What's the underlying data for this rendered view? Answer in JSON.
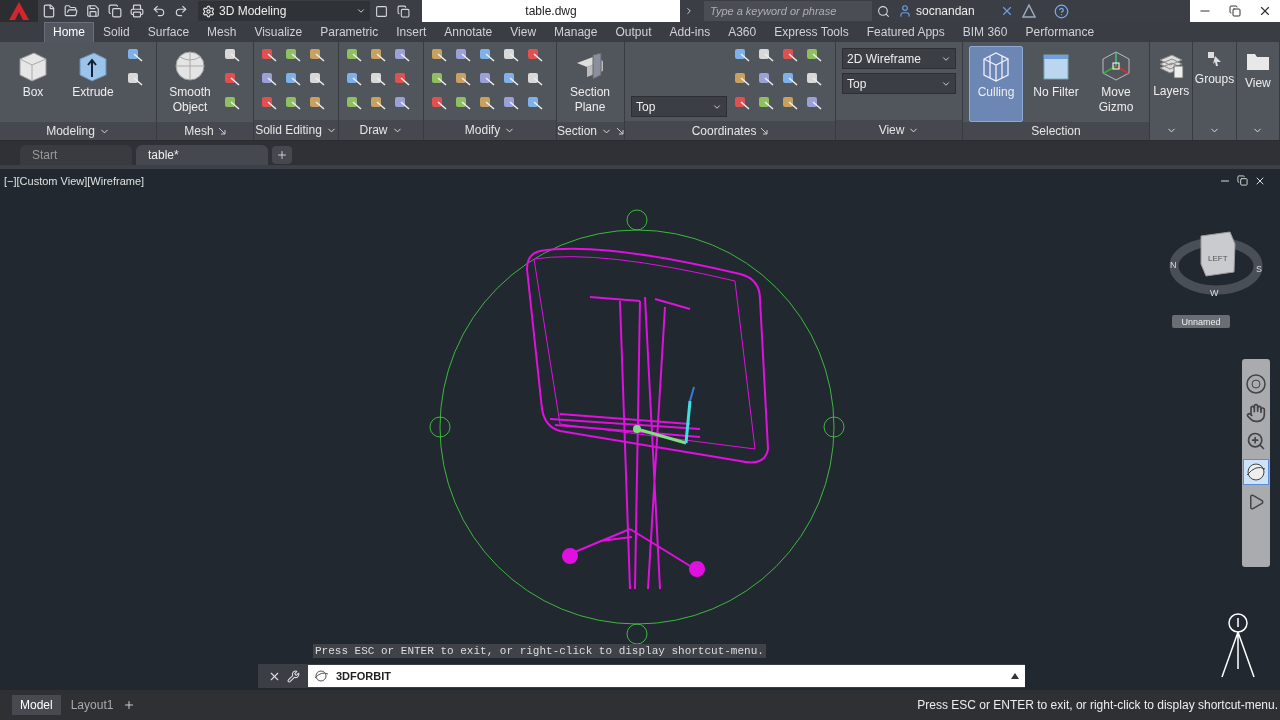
{
  "title_bar": {
    "workspace": "3D Modeling",
    "file_name": "table.dwg",
    "search": {
      "placeholder": "Type a keyword or phrase"
    },
    "user": "socnandan"
  },
  "ribbon_tabs": [
    {
      "label": "Home",
      "selected": true
    },
    {
      "label": "Solid",
      "selected": false
    },
    {
      "label": "Surface",
      "selected": false
    },
    {
      "label": "Mesh",
      "selected": false
    },
    {
      "label": "Visualize",
      "selected": false
    },
    {
      "label": "Parametric",
      "selected": false
    },
    {
      "label": "Insert",
      "selected": false
    },
    {
      "label": "Annotate",
      "selected": false
    },
    {
      "label": "View",
      "selected": false
    },
    {
      "label": "Manage",
      "selected": false
    },
    {
      "label": "Output",
      "selected": false
    },
    {
      "label": "Add-ins",
      "selected": false
    },
    {
      "label": "A360",
      "selected": false
    },
    {
      "label": "Express Tools",
      "selected": false
    },
    {
      "label": "Featured Apps",
      "selected": false
    },
    {
      "label": "BIM 360",
      "selected": false
    },
    {
      "label": "Performance",
      "selected": false
    }
  ],
  "ribbon_panels": [
    {
      "kind": "standard",
      "title": "Modeling",
      "menu": true,
      "launcher": false,
      "buttons": [
        {
          "kind": "box",
          "label": "Box",
          "selected": false
        },
        {
          "kind": "extrude",
          "label": "Extrude",
          "selected": false
        }
      ]
    },
    {
      "kind": "standard",
      "title": "Mesh",
      "menu": false,
      "launcher": true,
      "buttons": [
        {
          "kind": "sphere",
          "label": "Smooth Object",
          "selected": false
        }
      ]
    },
    {
      "kind": "standard",
      "title": "Solid Editing",
      "menu": true,
      "launcher": false
    },
    {
      "kind": "standard",
      "title": "Draw",
      "menu": true,
      "launcher": false
    },
    {
      "kind": "standard",
      "title": "Modify",
      "menu": true,
      "launcher": false
    },
    {
      "kind": "standard",
      "title": "Section",
      "menu": true,
      "launcher": true,
      "buttons": [
        {
          "kind": "plane",
          "label": "Section Plane",
          "selected": false
        }
      ]
    },
    {
      "kind": "standard",
      "title": "Coordinates",
      "menu": false,
      "launcher": true,
      "dropdowns": [
        {
          "value": "Top"
        }
      ]
    },
    {
      "kind": "standard",
      "title": "View",
      "menu": true,
      "launcher": false,
      "dropdowns": [
        {
          "value": "2D Wireframe"
        },
        {
          "value": "Top"
        }
      ]
    },
    {
      "kind": "standard",
      "title": "Selection",
      "menu": false,
      "launcher": false,
      "buttons": [
        {
          "kind": "culling",
          "label": "Culling",
          "selected": true
        },
        {
          "kind": "filter",
          "label": "No Filter",
          "selected": false
        },
        {
          "kind": "gizmo",
          "label": "Move Gizmo",
          "selected": false
        }
      ]
    },
    {
      "kind": "collapsed",
      "label": "Layers"
    },
    {
      "kind": "collapsed",
      "label": "Groups"
    },
    {
      "kind": "collapsed",
      "label": "View"
    }
  ],
  "file_tabs": [
    {
      "label": "Start",
      "selected": false
    },
    {
      "label": "table*",
      "selected": true
    }
  ],
  "viewport": {
    "label": "[−][Custom View][Wireframe]",
    "viewcube": {
      "face": "LEFT",
      "compass": [
        "N",
        "S",
        "W"
      ],
      "view_name": "Unnamed"
    }
  },
  "command_line": {
    "prompt": "Press ESC or ENTER to exit, or right-click to display shortcut-menu.",
    "value": "3DFORBIT"
  },
  "layout_tabs": [
    {
      "label": "Model",
      "selected": true
    },
    {
      "label": "Layout1",
      "selected": false
    }
  ],
  "status_message": "Press ESC or ENTER to exit, or right-click to display shortcut-menu."
}
